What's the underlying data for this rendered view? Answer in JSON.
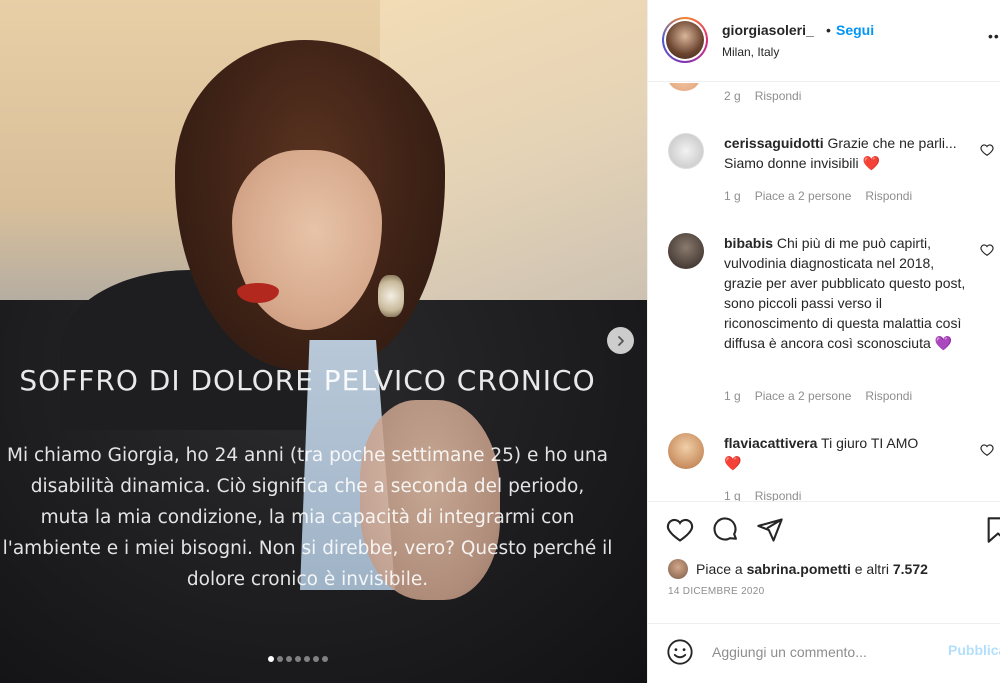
{
  "post": {
    "overlay_title": "SOFFRO DI DOLORE PELVICO CRONICO",
    "overlay_lines": [
      "Mi chiamo Giorgia, ho 24 anni (tra poche settimane 25) e ho una",
      "disabilità dinamica. Ciò significa che a seconda del periodo,",
      "muta la mia condizione, la mia capacità di integrarmi con",
      "l'ambiente e i miei bisogni. Non si direbbe, vero? Questo perché il",
      "dolore cronico è invisibile."
    ],
    "carousel_total": 7,
    "carousel_active_index": 0
  },
  "header": {
    "username": "giorgiasoleri_",
    "separator": "•",
    "follow_label": "Segui",
    "location": "Milan, Italy",
    "more_icon": "ellipsis-icon"
  },
  "comments": {
    "previous_meta": {
      "time": "2 g",
      "reply": "Rispondi"
    },
    "items": [
      {
        "username": "cerissaguidotti",
        "text": "Grazie che ne parli... Siamo donne invisibili",
        "emoji": "❤️",
        "time": "1 g",
        "likes": "Piace a 2 persone",
        "reply": "Rispondi"
      },
      {
        "username": "bibabis",
        "text": "Chi più di me può capirti, vulvodinia diagnosticata nel 2018, grazie per aver pubblicato questo post, sono piccoli passi verso il riconoscimento di questa malattia così diffusa è ancora così sconosciuta",
        "emoji": "💜",
        "time": "1 g",
        "likes": "Piace a 2 persone",
        "reply": "Rispondi"
      },
      {
        "username": "flaviacattivera",
        "text": "Ti giuro TI AMO",
        "emoji": "❤️",
        "time": "1 g",
        "likes": "",
        "reply": "Rispondi"
      }
    ]
  },
  "actions": {
    "likes_prefix": "Piace a",
    "likes_user": "sabrina.pometti",
    "likes_suffix": "e altri",
    "likes_count": "7.572",
    "date": "14 DICEMBRE 2020"
  },
  "add_comment": {
    "placeholder": "Aggiungi un commento...",
    "post_label": "Pubblica"
  },
  "colors": {
    "accent": "#0095f6",
    "heart": "#ed4956",
    "muted": "#8e8e8e"
  }
}
